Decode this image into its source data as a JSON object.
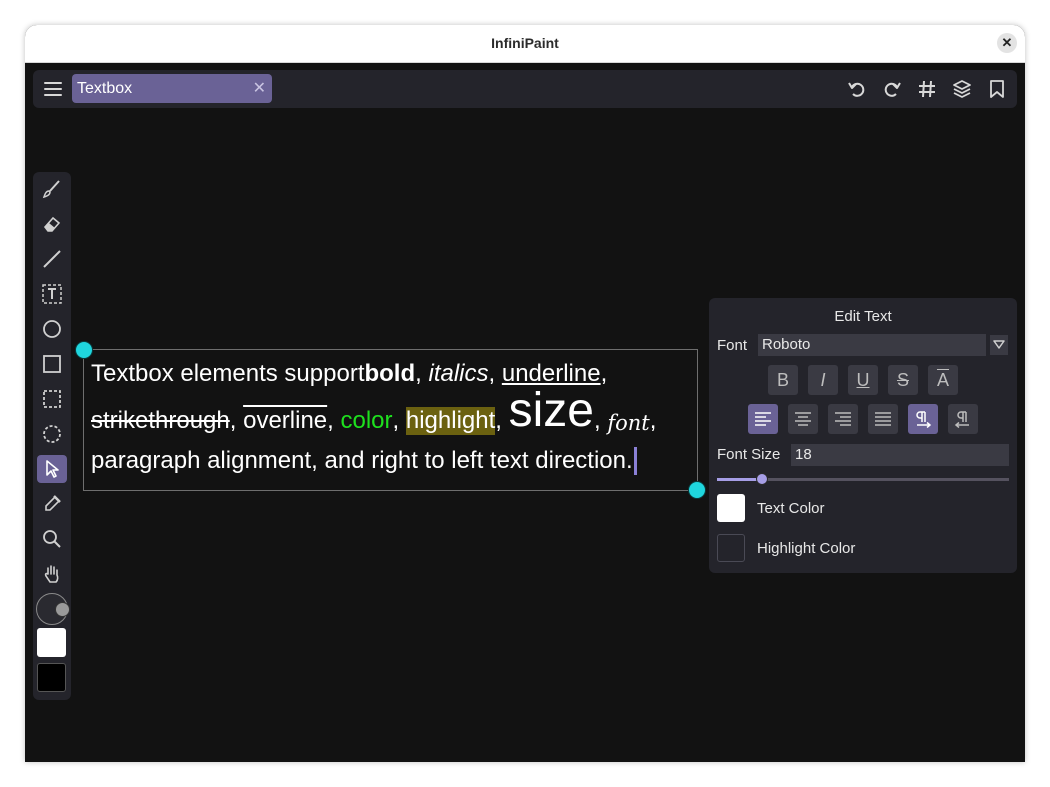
{
  "window": {
    "title": "InfiniPaint",
    "close_symbol": "✕"
  },
  "toolbar": {
    "menu_icon": "hamburger-menu-icon",
    "tab": {
      "label": "Textbox",
      "close_symbol": "✕"
    },
    "right_icons": [
      "undo-icon",
      "redo-icon",
      "grid-icon",
      "layers-icon",
      "bookmark-icon"
    ]
  },
  "tools": {
    "items": [
      "brush-icon",
      "eraser-icon",
      "line-icon",
      "text-tool-icon",
      "ellipse-icon",
      "rectangle-icon",
      "rect-select-icon",
      "lasso-select-icon",
      "pointer-icon",
      "eyedropper-icon",
      "zoom-icon",
      "pan-hand-icon"
    ],
    "active": "pointer-icon",
    "primary_color": "#ffffff",
    "secondary_color": "#000000"
  },
  "textbox": {
    "line1": {
      "a": "Textbox elements support ",
      "bold": "bold",
      "c1": ", ",
      "italic": "italics",
      "c2": ", ",
      "underline": "underline",
      "c3": ","
    },
    "line2": {
      "strike": "strikethrough",
      "c1": ", ",
      "overline": "overline",
      "c2": ", ",
      "color": "color",
      "c3": ", ",
      "highlight": "highlight",
      "c4": ", ",
      "size": "size",
      "c5": ", ",
      "font": "font",
      "c6": ","
    },
    "line3": "paragraph alignment, and right to left text direction.",
    "colors": {
      "text": "#ffffff",
      "green": "#1ee01e",
      "highlight_bg": "#6b6110",
      "handle": "#1fd6de"
    }
  },
  "edit_panel": {
    "title": "Edit Text",
    "font_label": "Font",
    "font_value": "Roboto",
    "format_buttons": [
      {
        "name": "bold-button",
        "glyph": "B"
      },
      {
        "name": "italic-button",
        "glyph": "I"
      },
      {
        "name": "underline-button",
        "glyph": "U"
      },
      {
        "name": "strikethrough-button",
        "glyph": "S"
      },
      {
        "name": "overline-button",
        "glyph": "A"
      }
    ],
    "align_buttons": [
      "align-left-icon",
      "align-center-icon",
      "align-right-icon",
      "align-justify-icon",
      "ltr-direction-icon",
      "rtl-direction-icon"
    ],
    "font_size_label": "Font Size",
    "font_size_value": "18",
    "font_size_slider_fraction": 0.15,
    "text_color_label": "Text Color",
    "text_color": "#ffffff",
    "highlight_color_label": "Highlight Color",
    "highlight_color": "#24242b",
    "accent": "#6a6296"
  }
}
